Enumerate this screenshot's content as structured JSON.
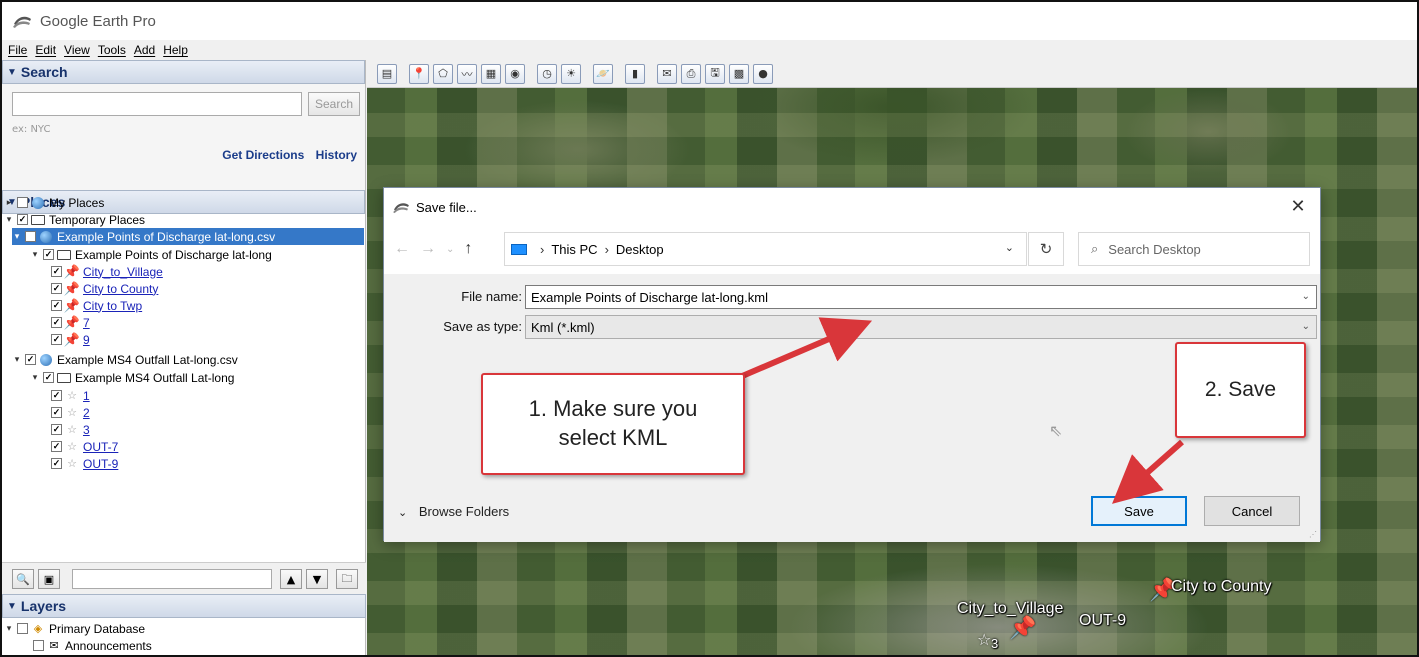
{
  "window": {
    "title": "Google Earth Pro"
  },
  "menu": [
    "File",
    "Edit",
    "View",
    "Tools",
    "Add",
    "Help"
  ],
  "search": {
    "header": "Search",
    "placeholder": "",
    "button": "Search",
    "hint": "ex: NYC",
    "get_directions": "Get Directions",
    "history": "History"
  },
  "places": {
    "header": "Places",
    "items": [
      {
        "label": "My Places"
      },
      {
        "label": "Temporary Places"
      },
      {
        "label": "Example Points of Discharge lat-long.csv"
      },
      {
        "label": "Example Points of Discharge lat-long"
      },
      {
        "label": "City_to_Village"
      },
      {
        "label": "City to County"
      },
      {
        "label": "City to Twp"
      },
      {
        "label": "7"
      },
      {
        "label": "9"
      },
      {
        "label": "Example MS4 Outfall Lat-long.csv"
      },
      {
        "label": "Example MS4 Outfall Lat-long"
      },
      {
        "label": "1"
      },
      {
        "label": "2"
      },
      {
        "label": "3"
      },
      {
        "label": "OUT-7"
      },
      {
        "label": "OUT-9"
      }
    ]
  },
  "layers": {
    "header": "Layers",
    "items": [
      {
        "label": "Primary Database"
      },
      {
        "label": "Announcements"
      }
    ]
  },
  "map_labels": {
    "city_to_village": "City_to_Village",
    "out_9": "OUT-9",
    "city_to_county": "City to County",
    "marker_3": "3"
  },
  "dialog": {
    "title": "Save file...",
    "breadcrumb": [
      "This PC",
      "Desktop"
    ],
    "search_placeholder": "Search Desktop",
    "file_name_label": "File name:",
    "file_name_value": "Example Points of Discharge lat-long.kml",
    "save_type_label": "Save as type:",
    "save_type_value": "Kml (*.kml)",
    "browse_folders": "Browse Folders",
    "save_button": "Save",
    "cancel_button": "Cancel"
  },
  "annotations": {
    "callout1_line1": "1. Make sure you",
    "callout1_line2": "select KML",
    "callout2": "2. Save",
    "color": "#d9363a"
  },
  "colors": {
    "accent": "#0078d7",
    "selection": "#3578c8",
    "section_header": "#17326b"
  }
}
